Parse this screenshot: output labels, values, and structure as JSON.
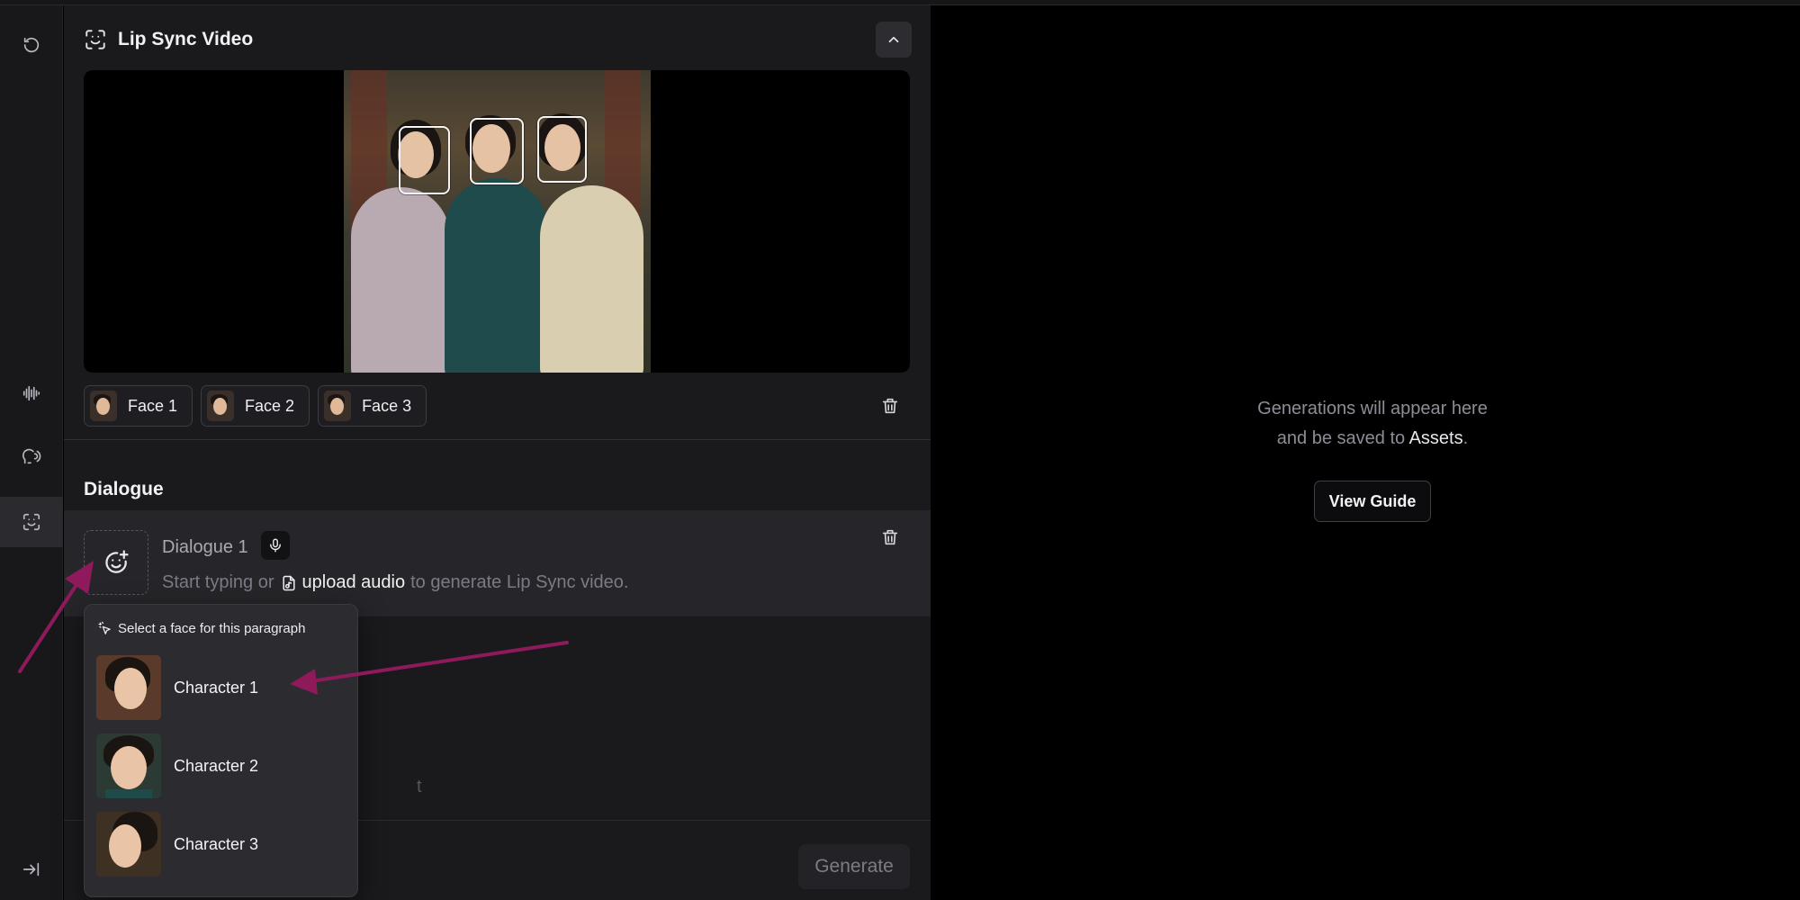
{
  "panel": {
    "title": "Lip Sync Video",
    "faces": [
      {
        "label": "Face 1"
      },
      {
        "label": "Face 2"
      },
      {
        "label": "Face 3"
      }
    ]
  },
  "dialogue": {
    "section_title": "Dialogue",
    "items": [
      {
        "name": "Dialogue 1",
        "prompt_start": "Start typing or",
        "upload_link": "upload audio",
        "prompt_end": "to generate Lip Sync video."
      }
    ],
    "partially_hidden_text": "t"
  },
  "face_menu": {
    "header": "Select a face for this paragraph",
    "options": [
      {
        "label": "Character 1"
      },
      {
        "label": "Character 2"
      },
      {
        "label": "Character 3"
      }
    ]
  },
  "footer": {
    "generate_label": "Generate"
  },
  "output": {
    "empty_line1": "Generations will appear here",
    "empty_line2_start": "and be saved to",
    "empty_line2_link": "Assets",
    "empty_line2_end": ".",
    "guide_label": "View Guide"
  },
  "colors": {
    "annotation_arrow": "#8e1a5c",
    "panel_bg": "#1a1a1d",
    "dialogue_card_bg": "#26262a"
  },
  "icons": {
    "rail": [
      "refresh-icon",
      "waveform-icon",
      "voice-icon",
      "face-scan-icon",
      "collapse-sidebar-icon"
    ]
  }
}
